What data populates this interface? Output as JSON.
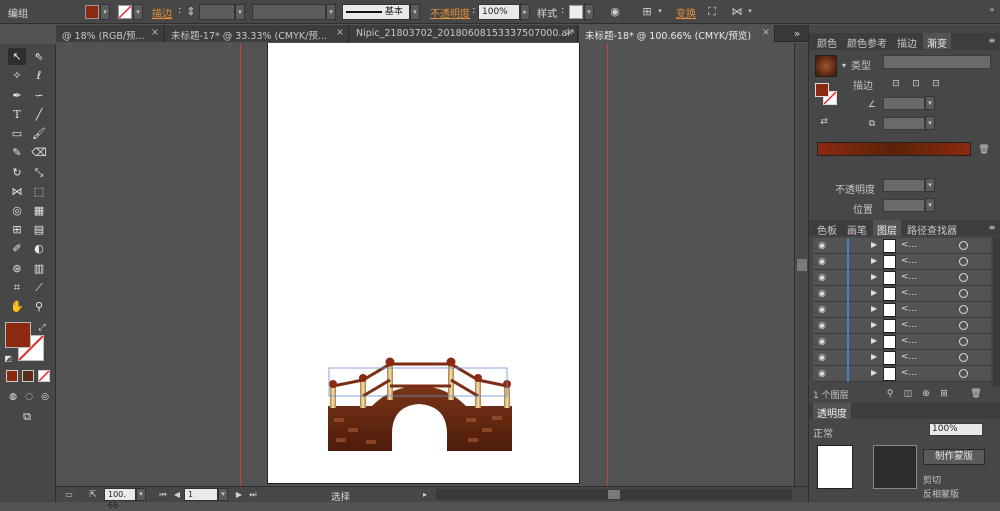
{
  "control_bar": {
    "group_label": "编组",
    "stroke_label": "描边",
    "stroke_style": "基本",
    "opacity_label": "不透明度",
    "opacity_value": "100%",
    "style_label": "样式",
    "transform_label": "变换",
    "fill_color": "#8b2a10"
  },
  "tabs": [
    {
      "label": "@ 18% (RGB/预...",
      "close": "×"
    },
    {
      "label": "未标题-17* @ 33.33% (CMYK/预...",
      "close": "×"
    },
    {
      "label": "Nipic_21803702_20180608153337507000.ai*",
      "close": "×"
    },
    {
      "label": "未标题-18* @ 100.66% (CMYK/预览)",
      "close": "×"
    }
  ],
  "status_bar": {
    "zoom": "100. 66",
    "page": "1",
    "tool_state": "选择"
  },
  "gradient_panel": {
    "tabs": [
      "颜色",
      "颜色参考",
      "描边",
      "渐变"
    ],
    "type_label": "类型",
    "stroke_label": "描边",
    "opacity_label": "不透明度",
    "position_label": "位置"
  },
  "layers_panel": {
    "tabs": [
      "色板",
      "画笔",
      "图层",
      "路径查找器"
    ],
    "rows": [
      {
        "name": "<..."
      },
      {
        "name": "<..."
      },
      {
        "name": "<..."
      },
      {
        "name": "<..."
      },
      {
        "name": "<..."
      },
      {
        "name": "<..."
      },
      {
        "name": "<..."
      },
      {
        "name": "<..."
      },
      {
        "name": "<..."
      }
    ],
    "count_label": "1 个图层"
  },
  "transparency_panel": {
    "tab": "透明度",
    "mode": "正常",
    "opacity_value": "100%",
    "make_mask_button": "制作蒙版",
    "clip_label": "剪切",
    "invert_label": "反相蒙版"
  },
  "colors": {
    "fill": "#8b2a10",
    "guide": "#c9423a",
    "layer_highlight": "#4b7dd8"
  }
}
